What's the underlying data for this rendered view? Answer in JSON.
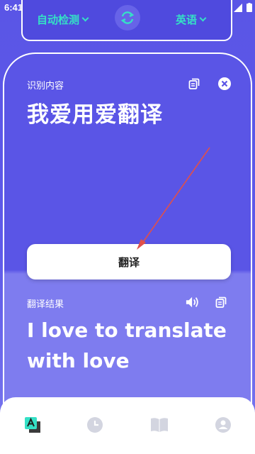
{
  "status_bar": {
    "time": "6:41"
  },
  "lang_bar": {
    "source": "自动检测",
    "target": "英语",
    "swap_icon": "swap-icon"
  },
  "source": {
    "label": "识别内容",
    "text": "我爱用爱翻译"
  },
  "action": {
    "translate_label": "翻译"
  },
  "result": {
    "label": "翻译结果",
    "line1": "I love to translate",
    "line2": "with love"
  },
  "nav": {
    "items": [
      "translate-icon",
      "history-icon",
      "book-icon",
      "profile-icon"
    ]
  },
  "colors": {
    "accent": "#35e0c6",
    "primary": "#5a55e6",
    "annotation": "#e0504a"
  }
}
